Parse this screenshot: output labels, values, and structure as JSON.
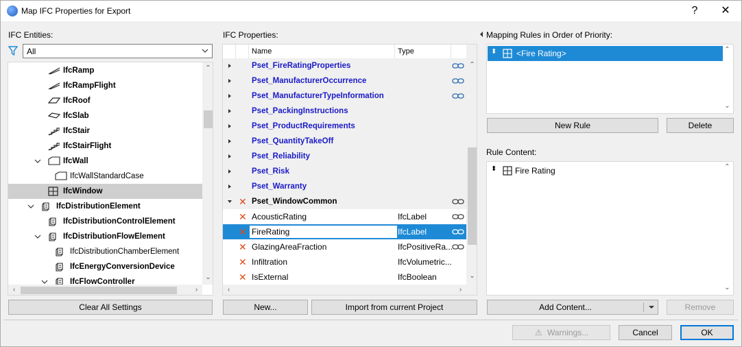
{
  "window": {
    "title": "Map IFC Properties for Export",
    "help": "?",
    "close": "✕"
  },
  "entities": {
    "label": "IFC Entities:",
    "filter_value": "All",
    "items": [
      {
        "label": "IfcRamp",
        "indent": 3,
        "icon": "ramp",
        "bold": true
      },
      {
        "label": "IfcRampFlight",
        "indent": 3,
        "icon": "ramp",
        "bold": true
      },
      {
        "label": "IfcRoof",
        "indent": 3,
        "icon": "roof",
        "bold": true
      },
      {
        "label": "IfcSlab",
        "indent": 3,
        "icon": "slab",
        "bold": true
      },
      {
        "label": "IfcStair",
        "indent": 3,
        "icon": "stair",
        "bold": true
      },
      {
        "label": "IfcStairFlight",
        "indent": 3,
        "icon": "stair",
        "bold": true
      },
      {
        "label": "IfcWall",
        "indent": 3,
        "icon": "wall",
        "bold": true,
        "expander": "open"
      },
      {
        "label": "IfcWallStandardCase",
        "indent": 4,
        "icon": "wall",
        "bold": false
      },
      {
        "label": "IfcWindow",
        "indent": 3,
        "icon": "window",
        "bold": true,
        "selected": true
      },
      {
        "label": "IfcDistributionElement",
        "indent": 2,
        "icon": "dist",
        "bold": true,
        "expander": "open"
      },
      {
        "label": "IfcDistributionControlElement",
        "indent": 3,
        "icon": "dist",
        "bold": true
      },
      {
        "label": "IfcDistributionFlowElement",
        "indent": 3,
        "icon": "dist",
        "bold": true,
        "expander": "open"
      },
      {
        "label": "IfcDistributionChamberElement",
        "indent": 4,
        "icon": "dist",
        "bold": false
      },
      {
        "label": "IfcEnergyConversionDevice",
        "indent": 4,
        "icon": "dist",
        "bold": true
      },
      {
        "label": "IfcFlowController",
        "indent": 4,
        "icon": "dist",
        "bold": true,
        "expander": "open"
      }
    ],
    "clear_label": "Clear All Settings"
  },
  "properties": {
    "label": "IFC Properties:",
    "col_name": "Name",
    "col_type": "Type",
    "rows": [
      {
        "name": "Pset_FireRatingProperties",
        "type": "",
        "kind": "pset",
        "chain": "blue"
      },
      {
        "name": "Pset_ManufacturerOccurrence",
        "type": "",
        "kind": "pset",
        "chain": "blue"
      },
      {
        "name": "Pset_ManufacturerTypeInformation",
        "type": "",
        "kind": "pset",
        "chain": "blue"
      },
      {
        "name": "Pset_PackingInstructions",
        "type": "",
        "kind": "pset",
        "chain": ""
      },
      {
        "name": "Pset_ProductRequirements",
        "type": "",
        "kind": "pset",
        "chain": ""
      },
      {
        "name": "Pset_QuantityTakeOff",
        "type": "",
        "kind": "pset",
        "chain": ""
      },
      {
        "name": "Pset_Reliability",
        "type": "",
        "kind": "pset",
        "chain": ""
      },
      {
        "name": "Pset_Risk",
        "type": "",
        "kind": "pset",
        "chain": ""
      },
      {
        "name": "Pset_Warranty",
        "type": "",
        "kind": "pset",
        "chain": ""
      },
      {
        "name": "Pset_WindowCommon",
        "type": "",
        "kind": "open",
        "chain": "gray"
      },
      {
        "name": "AcousticRating",
        "type": "IfcLabel",
        "kind": "prop",
        "chain": "gray"
      },
      {
        "name": "FireRating",
        "type": "IfcLabel",
        "kind": "prop",
        "chain": "gray",
        "selected": true
      },
      {
        "name": "GlazingAreaFraction",
        "type": "IfcPositiveRa...",
        "kind": "prop",
        "chain": "gray"
      },
      {
        "name": "Infiltration",
        "type": "IfcVolumetric...",
        "kind": "prop",
        "chain": ""
      },
      {
        "name": "IsExternal",
        "type": "IfcBoolean",
        "kind": "prop",
        "chain": ""
      }
    ],
    "new_label": "New...",
    "import_label": "Import from current Project"
  },
  "mapping": {
    "label": "Mapping Rules in Order of Priority:",
    "rule": "<Fire Rating>",
    "new_rule_label": "New Rule",
    "delete_label": "Delete",
    "content_label": "Rule Content:",
    "content_item": "Fire Rating",
    "add_content_label": "Add Content...",
    "remove_label": "Remove"
  },
  "footer": {
    "warnings_label": "Warnings...",
    "cancel_label": "Cancel",
    "ok_label": "OK"
  },
  "colors": {
    "accent": "#1e8ad6",
    "pset_text": "#1a1ac8",
    "remove_mark": "#e04a1a"
  }
}
